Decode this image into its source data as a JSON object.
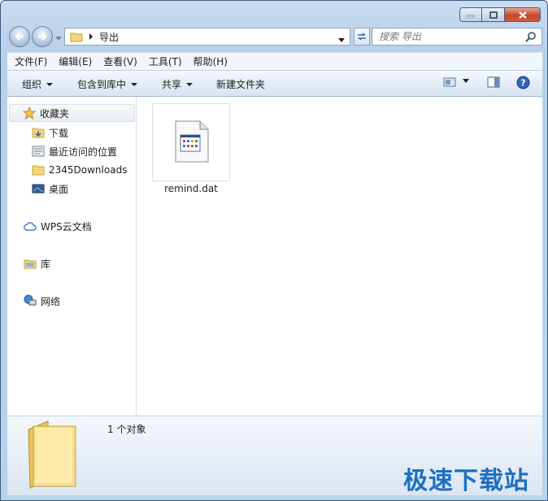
{
  "address": {
    "segment": "导出"
  },
  "search": {
    "placeholder": "搜索 导出"
  },
  "menu": [
    "文件(F)",
    "编辑(E)",
    "查看(V)",
    "工具(T)",
    "帮助(H)"
  ],
  "commands": {
    "organize": "组织",
    "include_library": "包含到库中",
    "share": "共享",
    "new_folder": "新建文件夹"
  },
  "navpane": {
    "favorites": "收藏夹",
    "downloads": "下载",
    "recent": "最近访问的位置",
    "downloads2345": "2345Downloads",
    "desktop": "桌面",
    "wps": "WPS云文档",
    "library": "库",
    "network": "网络"
  },
  "files": [
    {
      "name": "remind.dat"
    }
  ],
  "details": {
    "count": "1 个对象"
  },
  "watermark": "极速下载站",
  "colors": {
    "accent": "#1d6fc3",
    "window_frame": "#b9d1ea"
  }
}
